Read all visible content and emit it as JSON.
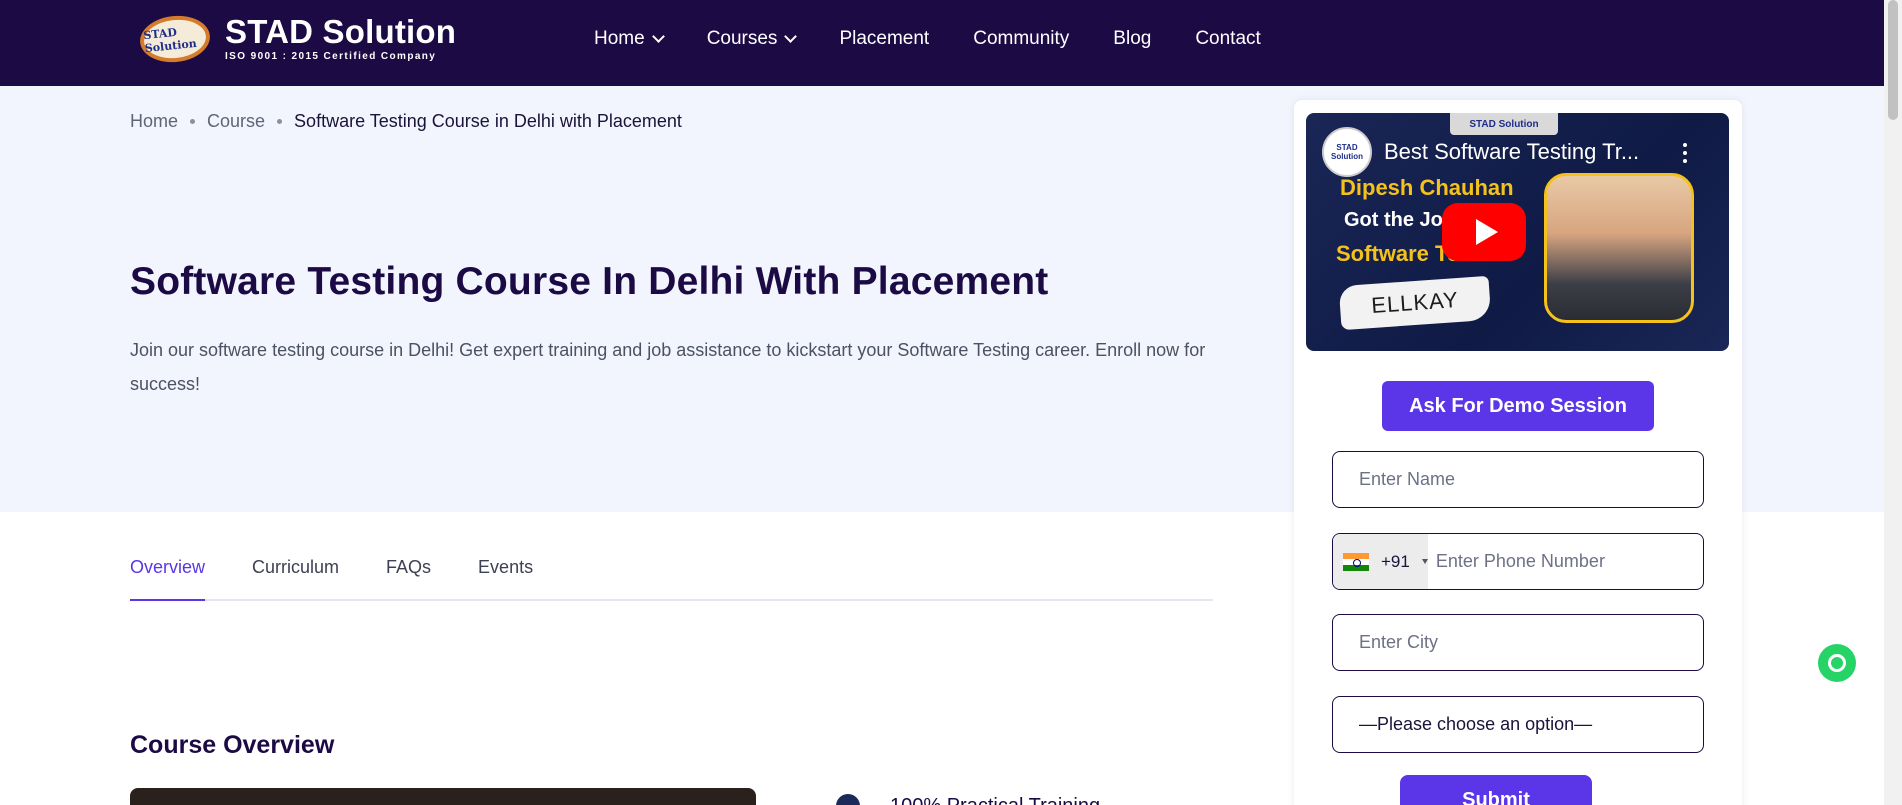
{
  "header": {
    "logo_badge": "STAD\nSolution",
    "brand": "STAD Solution",
    "tagline": "ISO 9001 : 2015 Certified Company",
    "nav": [
      {
        "label": "Home",
        "dropdown": true
      },
      {
        "label": "Courses",
        "dropdown": true
      },
      {
        "label": "Placement",
        "dropdown": false
      },
      {
        "label": "Community",
        "dropdown": false
      },
      {
        "label": "Blog",
        "dropdown": false
      },
      {
        "label": "Contact",
        "dropdown": false
      }
    ]
  },
  "breadcrumb": [
    "Home",
    "Course",
    "Software Testing Course in Delhi with Placement"
  ],
  "hero": {
    "title": "Software Testing Course In Delhi With Placement",
    "description": "Join our software testing course in Delhi! Get expert training and job assistance to kickstart your Software Testing career. Enroll now for success!"
  },
  "tabs": [
    {
      "label": "Overview",
      "active": true
    },
    {
      "label": "Curriculum",
      "active": false
    },
    {
      "label": "FAQs",
      "active": false
    },
    {
      "label": "Events",
      "active": false
    }
  ],
  "overview": {
    "section_title": "Course Overview",
    "feature_1": "100% Practical Training"
  },
  "video": {
    "channel_badge": "STAD Solution",
    "title": "Best Software Testing Tr...",
    "brand_tag": "STAD Solution",
    "line1": "Dipesh Chauhan",
    "line2": "Got the Job as",
    "line3": "Software Tester",
    "company": "ELLKAY"
  },
  "form": {
    "demo_button": "Ask For Demo Session",
    "name_placeholder": "Enter Name",
    "country_code": "+91",
    "phone_placeholder": "Enter Phone Number",
    "city_placeholder": "Enter City",
    "select_value": "—Please choose an option—",
    "submit_label": "Submit"
  },
  "colors": {
    "header_bg": "#1c0a45",
    "accent": "#5b35e8",
    "hero_bg": "#f2f5fd",
    "whatsapp": "#25d366"
  }
}
